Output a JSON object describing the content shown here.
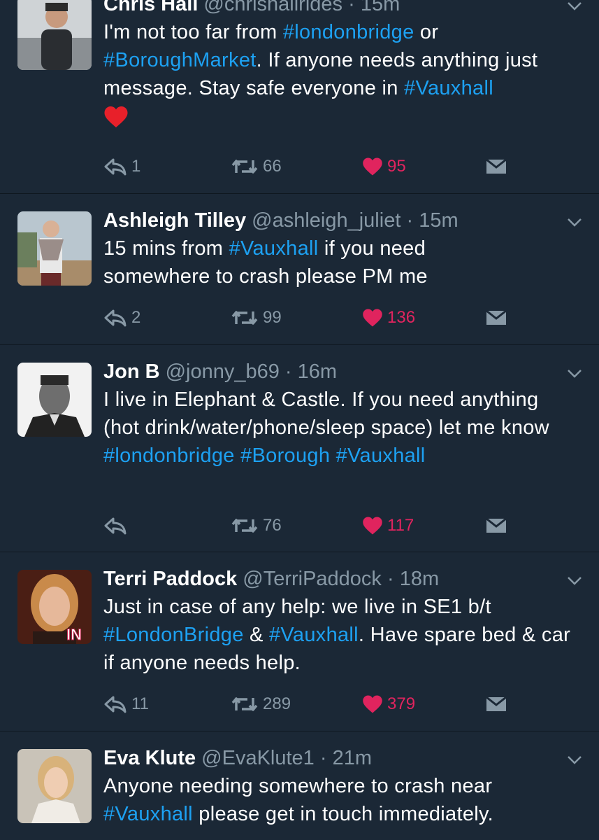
{
  "tweets": [
    {
      "name": "Chris Hall",
      "handle": "@chrishallrides",
      "separator": "·",
      "time": "15m",
      "segments": [
        {
          "t": "I'm not too far from ",
          "tag": false
        },
        {
          "t": "#londonbridge",
          "tag": true
        },
        {
          "t": " or ",
          "tag": false
        },
        {
          "t": "#BoroughMarket",
          "tag": true
        },
        {
          "t": ". If anyone needs anything just message. Stay safe everyone in ",
          "tag": false
        },
        {
          "t": "#Vauxhall",
          "tag": true
        }
      ],
      "emoji": "heart",
      "replies": "1",
      "retweets": "66",
      "likes": "95"
    },
    {
      "name": "Ashleigh Tilley",
      "handle": "@ashleigh_juliet",
      "separator": "·",
      "time": "15m",
      "segments": [
        {
          "t": "15 mins from ",
          "tag": false
        },
        {
          "t": "#Vauxhall",
          "tag": true
        },
        {
          "t": " if you need somewhere to crash please PM me",
          "tag": false
        }
      ],
      "replies": "2",
      "retweets": "99",
      "likes": "136"
    },
    {
      "name": "Jon B",
      "handle": "@jonny_b69",
      "separator": "·",
      "time": "16m",
      "segments": [
        {
          "t": "I live in Elephant & Castle. If you need anything (hot drink/water/phone/sleep space) let me know ",
          "tag": false
        },
        {
          "t": "#londonbridge",
          "tag": true
        },
        {
          "t": " ",
          "tag": false
        },
        {
          "t": "#Borough",
          "tag": true
        },
        {
          "t": " ",
          "tag": false
        },
        {
          "t": "#Vauxhall",
          "tag": true
        }
      ],
      "replies": "",
      "retweets": "76",
      "likes": "117"
    },
    {
      "name": "Terri Paddock",
      "handle": "@TerriPaddock",
      "separator": "·",
      "time": "18m",
      "segments": [
        {
          "t": "Just in case of any help: we live in SE1 b/t ",
          "tag": false
        },
        {
          "t": "#LondonBridge",
          "tag": true
        },
        {
          "t": " & ",
          "tag": false
        },
        {
          "t": "#Vauxhall",
          "tag": true
        },
        {
          "t": ". Have spare bed & car if anyone needs help.",
          "tag": false
        }
      ],
      "avatar_badge": "IN",
      "replies": "11",
      "retweets": "289",
      "likes": "379"
    },
    {
      "name": "Eva Klute",
      "handle": "@EvaKlute1",
      "separator": "·",
      "time": "21m",
      "segments": [
        {
          "t": "Anyone needing somewhere to crash near ",
          "tag": false
        },
        {
          "t": "#Vauxhall",
          "tag": true
        },
        {
          "t": " please get in touch immediately.",
          "tag": false
        }
      ]
    }
  ],
  "icons": {
    "reply": "reply-icon",
    "retweet": "retweet-icon",
    "like": "heart-icon",
    "dm": "direct-message-icon",
    "caret": "chevron-down-icon"
  },
  "colors": {
    "background": "#1b2836",
    "text": "#ffffff",
    "secondary": "#8899a6",
    "hashtag": "#1da1f2",
    "like": "#e0245e"
  }
}
